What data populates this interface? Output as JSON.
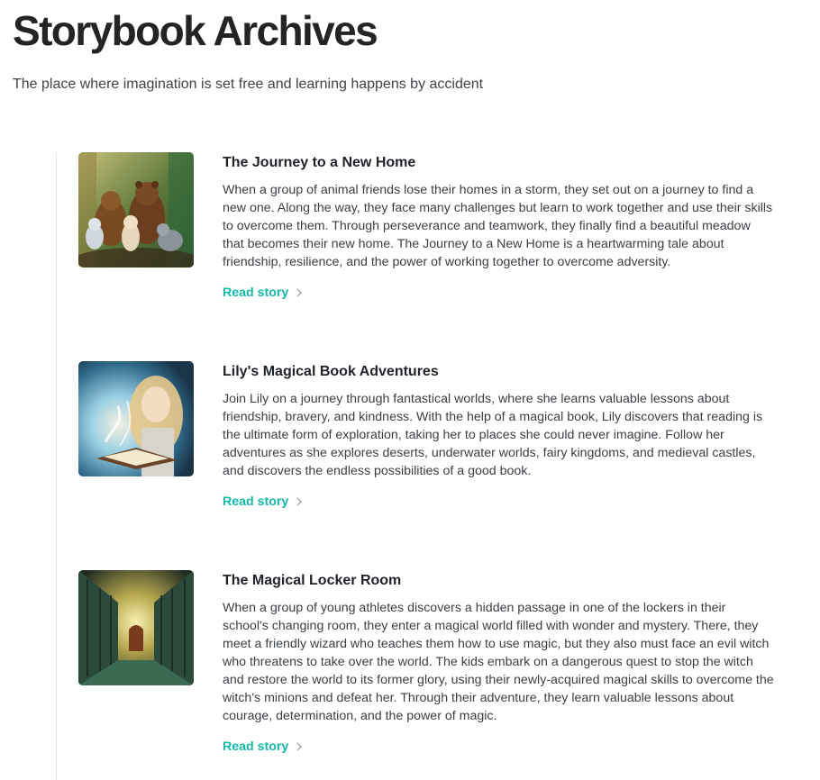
{
  "header": {
    "title": "Storybook Archives",
    "subtitle": "The place where imagination is set free and learning happens by accident"
  },
  "stories": [
    {
      "title": "The Journey to a New Home",
      "description": "When a group of animal friends lose their homes in a storm, they set out on a journey to find a new one. Along the way, they face many challenges but learn to work together and use their skills to overcome them. Through perseverance and teamwork, they finally find a beautiful meadow that becomes their new home. The Journey to a New Home is a heartwarming tale about friendship, resilience, and the power of working together to overcome adversity.",
      "link_label": "Read story",
      "image_icon": "animal-friends-illustration"
    },
    {
      "title": "Lily's Magical Book Adventures",
      "description": "Join Lily on a journey through fantastical worlds, where she learns valuable lessons about friendship, bravery, and kindness. With the help of a magical book, Lily discovers that reading is the ultimate form of exploration, taking her to places she could never imagine. Follow her adventures as she explores deserts, underwater worlds, fairy kingdoms, and medieval castles, and discovers the endless possibilities of a good book.",
      "link_label": "Read story",
      "image_icon": "girl-with-magic-book-illustration"
    },
    {
      "title": "The Magical Locker Room",
      "description": "When a group of young athletes discovers a hidden passage in one of the lockers in their school's changing room, they enter a magical world filled with wonder and mystery. There, they meet a friendly wizard who teaches them how to use magic, but they also must face an evil witch who threatens to take over the world. The kids embark on a dangerous quest to stop the witch and restore the world to its former glory, using their newly-acquired magical skills to overcome the witch's minions and defeat her. Through their adventure, they learn valuable lessons about courage, determination, and the power of magic.",
      "link_label": "Read story",
      "image_icon": "locker-room-hallway-illustration"
    }
  ],
  "colors": {
    "accent": "#14b8a6",
    "title": "#222426",
    "text": "#3a3f44",
    "timeline": "#e3e5e8"
  }
}
